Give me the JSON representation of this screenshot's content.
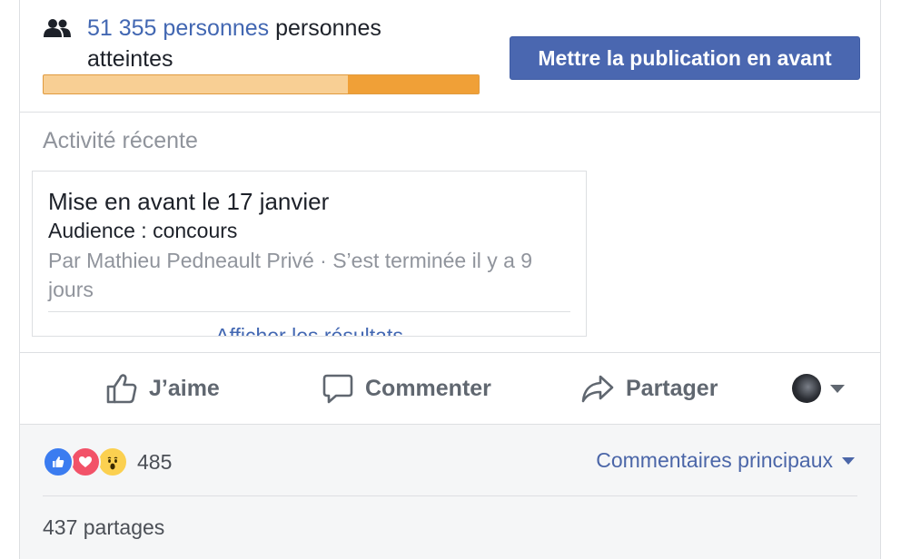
{
  "reach": {
    "count": "51 355 personnes",
    "suffix": " personnes atteintes",
    "organic_fraction": 0.7,
    "paid_fraction": 0.3
  },
  "boost_button": "Mettre la publication en avant",
  "activity": {
    "title": "Activité récente",
    "headline": "Mise en avant le 17 janvier",
    "audience": "Audience : concours",
    "meta": "Par Mathieu Pedneault Privé · S’est terminée il y a 9 jours",
    "results_link": "Afficher les résultats"
  },
  "actions": {
    "like": "J’aime",
    "comment": "Commenter",
    "share": "Partager"
  },
  "footer": {
    "reactions_count": "485",
    "sort_label": "Commentaires principaux",
    "shares": "437 partages"
  },
  "colors": {
    "brand_blue": "#4267b2",
    "button_blue": "#4a67b0",
    "bar_light": "#f8cf94",
    "bar_dark": "#f0a037"
  }
}
